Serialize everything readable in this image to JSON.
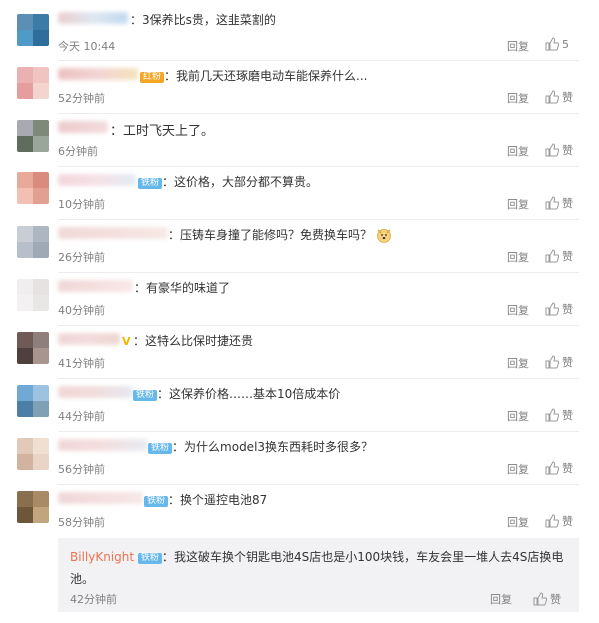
{
  "comments": [
    {
      "text": "3保养比s贵，这韭菜割的",
      "time": "今天 10:44",
      "reply": "回复",
      "like": "5",
      "badge": ""
    },
    {
      "text": "我前几天还琢磨电动车能保养什么...",
      "time": "52分钟前",
      "reply": "回复",
      "like": "赞",
      "badge": "红粉"
    },
    {
      "text": "工时飞天上了。",
      "time": "6分钟前",
      "reply": "回复",
      "like": "赞",
      "badge": ""
    },
    {
      "text": "这价格，大部分都不算贵。",
      "time": "10分钟前",
      "reply": "回复",
      "like": "赞",
      "badge": "铁粉"
    },
    {
      "text": "压铸车身撞了能修吗？免费换车吗？",
      "time": "26分钟前",
      "reply": "回复",
      "like": "赞",
      "badge": ""
    },
    {
      "text": "有豪华的味道了",
      "time": "40分钟前",
      "reply": "回复",
      "like": "赞",
      "badge": ""
    },
    {
      "text": "这特么比保时捷还贵",
      "time": "41分钟前",
      "reply": "回复",
      "like": "赞",
      "badge": "V"
    },
    {
      "text": "这保养价格……基本10倍成本价",
      "time": "44分钟前",
      "reply": "回复",
      "like": "赞",
      "badge": "铁粉"
    },
    {
      "text": "为什么model3换东西耗时多很多？",
      "time": "56分钟前",
      "reply": "回复",
      "like": "赞",
      "badge": "铁粉"
    },
    {
      "text": "换个遥控电池87",
      "time": "58分钟前",
      "reply": "回复",
      "like": "赞",
      "badge": "铁粉"
    }
  ],
  "sub_reply": {
    "name": "BillyKnight",
    "badge": "铁粉",
    "text": "我这破车换个钥匙电池4S店也是小100块钱，车友会里一堆人去4S店换电池。",
    "time": "42分钟前",
    "reply": "回复",
    "like": "赞"
  },
  "colors": {
    "link": "#eb7350",
    "meta": "#808080",
    "badge": "#66b8ea",
    "sub_bg": "#f2f2f5"
  },
  "icons": {
    "like": "thumbs-up-icon",
    "emoji": "dog-face-emoji"
  }
}
